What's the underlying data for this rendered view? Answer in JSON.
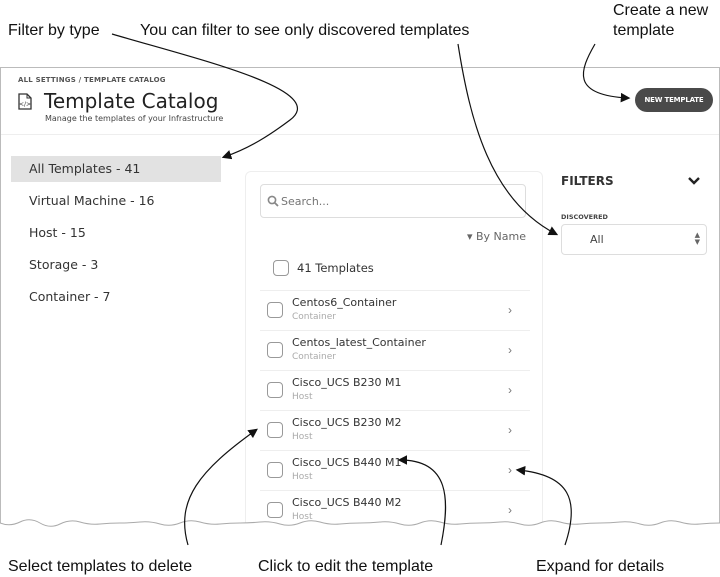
{
  "annotations": {
    "filter_by_type": "Filter by type",
    "filter_discovered": "You can filter to see only discovered templates",
    "create_new": "Create a new template",
    "select_delete": "Select templates to delete",
    "click_edit": "Click to edit the template",
    "expand_details": "Expand for details"
  },
  "header": {
    "breadcrumb": "ALL SETTINGS / TEMPLATE CATALOG",
    "title": "Template Catalog",
    "subtitle": "Manage the templates of your Infrastructure",
    "title_icon": "template-file-icon",
    "new_template_label": "NEW TEMPLATE",
    "new_template_color": "#4a4a4a"
  },
  "sidebar": {
    "items": [
      {
        "label": "All Templates - 41",
        "active": true
      },
      {
        "label": "Virtual Machine - 16",
        "active": false
      },
      {
        "label": "Host - 15",
        "active": false
      },
      {
        "label": "Storage - 3",
        "active": false
      },
      {
        "label": "Container - 7",
        "active": false
      }
    ]
  },
  "list": {
    "search_placeholder": "Search...",
    "search_icon": "search-icon",
    "sort_label": "▾ By Name",
    "select_all_label": "41 Templates",
    "rows": [
      {
        "name": "Centos6_Container",
        "type": "Container"
      },
      {
        "name": "Centos_latest_Container",
        "type": "Container"
      },
      {
        "name": "Cisco_UCS B230 M1",
        "type": "Host"
      },
      {
        "name": "Cisco_UCS B230 M2",
        "type": "Host"
      },
      {
        "name": "Cisco_UCS B440 M1",
        "type": "Host"
      },
      {
        "name": "Cisco_UCS B440 M2",
        "type": "Host"
      }
    ],
    "chevron": "›"
  },
  "filters": {
    "title": "FILTERS",
    "discovered_label": "DISCOVERED",
    "discovered_value": "All"
  }
}
